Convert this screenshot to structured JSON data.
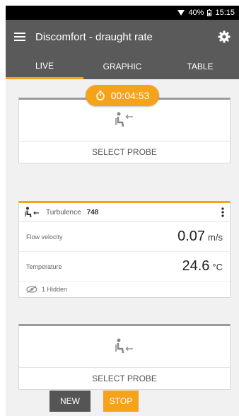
{
  "status": {
    "battery": "40%",
    "time": "15:15"
  },
  "appbar": {
    "title": "Discomfort - draught rate",
    "menu_icon": "menu-icon",
    "settings_icon": "gear-icon"
  },
  "tabs": [
    {
      "label": "LIVE",
      "active": true
    },
    {
      "label": "GRAPHIC",
      "active": false
    },
    {
      "label": "TABLE",
      "active": false
    }
  ],
  "timer": {
    "value": "00:04:53",
    "icon": "stopwatch-icon"
  },
  "probe_cards": [
    {
      "select_label": "SELECT PROBE",
      "icon": "seated-person-icon"
    },
    {
      "select_label": "SELECT PROBE",
      "icon": "seated-person-icon"
    }
  ],
  "measurement_card": {
    "probe_label": "Turbulence",
    "probe_value": "748",
    "rows": [
      {
        "label": "Flow velocity",
        "value": "0.07",
        "unit": "m/s"
      },
      {
        "label": "Temperature",
        "value": "24.6",
        "unit": "°C"
      }
    ],
    "hidden_label": "1 Hidden"
  },
  "buttons": {
    "new_label": "NEW",
    "stop_label": "STOP"
  },
  "colors": {
    "accent": "#f6a31c",
    "appbar": "#5a5a5a",
    "background": "#f1f1f1"
  }
}
